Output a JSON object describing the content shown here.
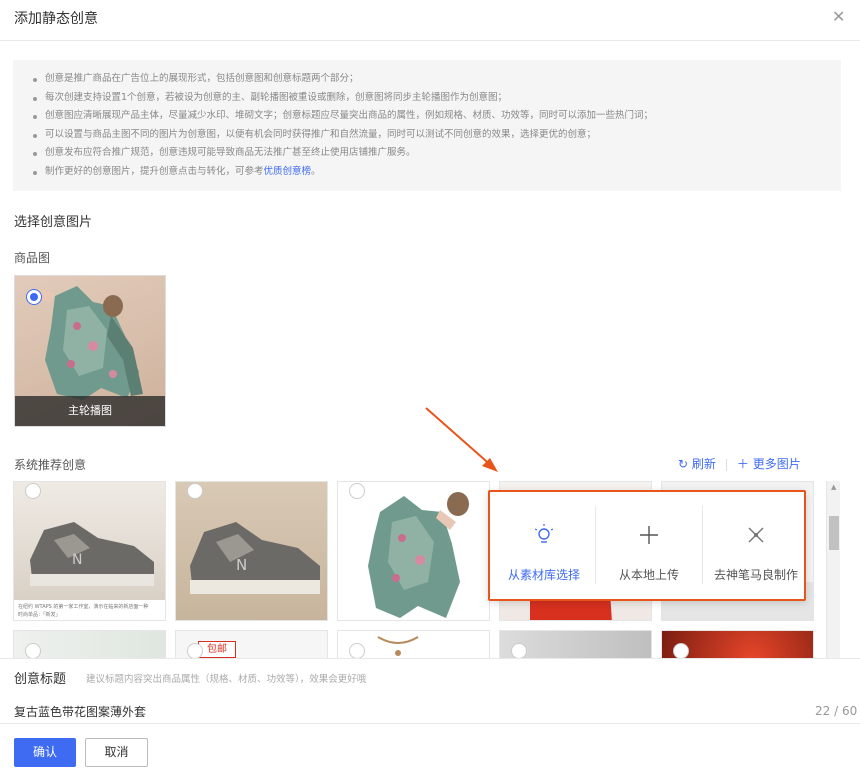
{
  "dialog": {
    "title": "添加静态创意",
    "close_icon": "close-icon"
  },
  "notice": {
    "items": [
      "创意是推广商品在广告位上的展现形式，包括创意图和创意标题两个部分；",
      "每次创建支持设置1个创意，若被设为创意的主、副轮播图被重设或删除，创意图将同步主轮播图作为创意图；",
      "创意图应清晰展现产品主体，尽量减少水印、堆砌文字；创意标题应尽量突出商品的属性，例如规格、材质、功效等，同时可以添加一些热门词；",
      "可以设置与商品主图不同的图片为创意图，以便有机会同时获得推广和自然流量，同时可以测试不同创意的效果，选择更优的创意；",
      "创意发布应符合推广规范，创意违规可能导致商品无法推广甚至终止使用店铺推广服务。"
    ],
    "last_item_prefix": "制作更好的创意图片，提升创意点击与转化，可参考",
    "last_item_link": "优质创意榜",
    "last_item_suffix": "。"
  },
  "section_title": "选择创意图片",
  "product_image": {
    "label": "商品图",
    "caption": "主轮播图"
  },
  "recommend": {
    "label": "系统推荐创意",
    "refresh_label": "刷新",
    "more_label": "更多图片",
    "card1_text1": "在纽约 WTAPS 的第一家工作室，演示在临来的新店面一种",
    "card1_text2": "时尚单品：「新发」",
    "tag_text": "包邮"
  },
  "upload_popup": {
    "options": [
      {
        "label": "从素材库选择",
        "icon": "lightbulb-icon"
      },
      {
        "label": "从本地上传",
        "icon": "plus-icon"
      },
      {
        "label": "去神笔马良制作",
        "icon": "pen-ruler-icon"
      }
    ]
  },
  "creative_title": {
    "label": "创意标题",
    "hint": "建议标题内容突出商品属性（规格、材质、功效等），效果会更好哦",
    "value": "复古蓝色带花图案薄外套",
    "count": "22 / 60"
  },
  "footer": {
    "confirm_label": "确认",
    "cancel_label": "取消"
  },
  "colors": {
    "accent": "#3f6bf3",
    "highlight": "#e8541a"
  }
}
